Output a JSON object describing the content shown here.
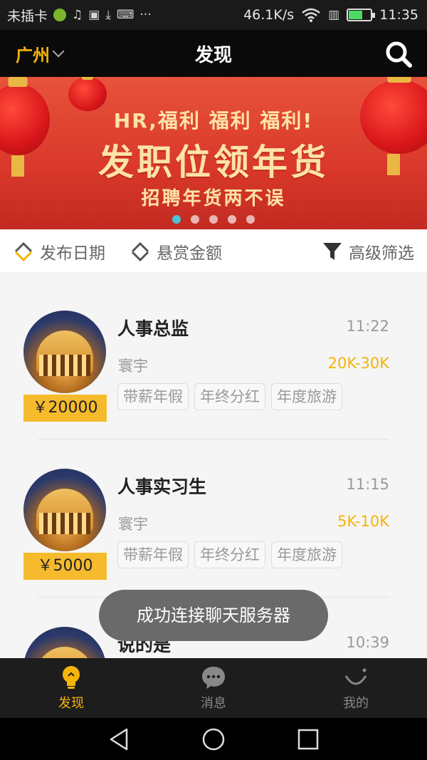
{
  "status_bar": {
    "carrier": "未插卡",
    "speed": "46.1K/s",
    "time": "11:35",
    "more": "···",
    "battery_level": 0.6
  },
  "header": {
    "city": "广州",
    "title": "发现"
  },
  "banner": {
    "line1": "HR,福利 福利 福利!",
    "line2": "发职位领年货",
    "line3": "招聘年货两不误",
    "page_count": 5,
    "active_page": 1
  },
  "filters": {
    "date_label": "发布日期",
    "reward_label": "悬赏金额",
    "advanced_label": "高级筛选"
  },
  "jobs": [
    {
      "title": "人事总监",
      "time": "11:22",
      "company": "寰宇",
      "salary": "20K-30K",
      "reward": "￥20000",
      "tags": [
        "带薪年假",
        "年终分红",
        "年度旅游"
      ]
    },
    {
      "title": "人事实习生",
      "time": "11:15",
      "company": "寰宇",
      "salary": "5K-10K",
      "reward": "￥5000",
      "tags": [
        "带薪年假",
        "年终分红",
        "年度旅游"
      ]
    },
    {
      "title": "说的是",
      "time": "10:39"
    }
  ],
  "toast": "成功连接聊天服务器",
  "tabbar": {
    "discover": "发现",
    "messages": "消息",
    "mine": "我的"
  },
  "colors": {
    "accent": "#f5b40a",
    "header_bg": "#0a0a0a",
    "tabbar_bg": "#1d1d1d",
    "reward_bg": "#f6bb2c"
  }
}
